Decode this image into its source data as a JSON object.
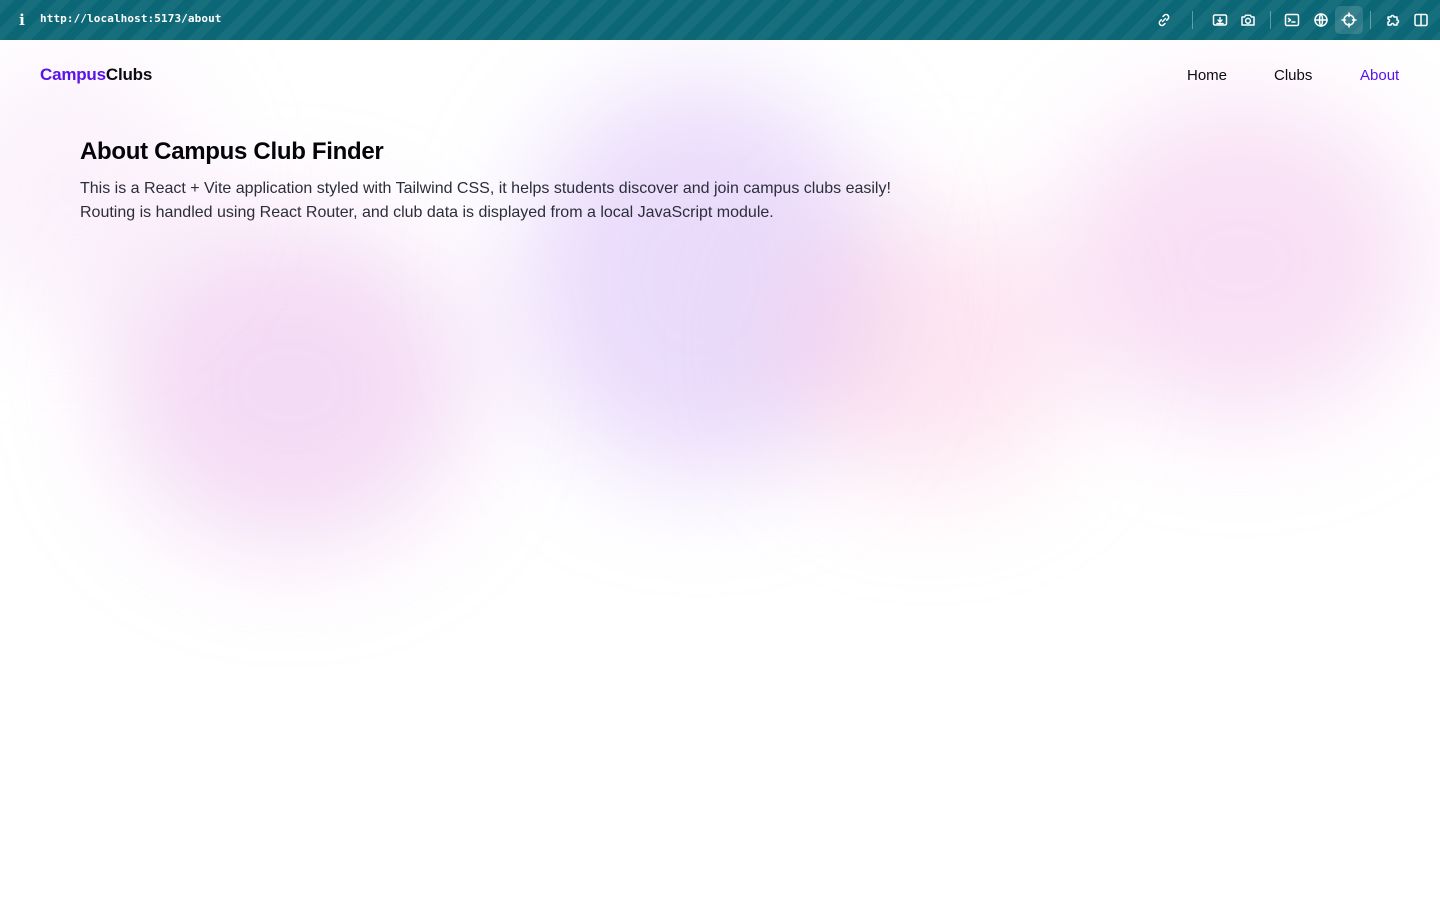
{
  "browser": {
    "url": "http://localhost:5173/about",
    "icons": [
      "info-icon",
      "link-icon",
      "download-icon",
      "camera-icon",
      "terminal-icon",
      "globe-icon",
      "crosshair-icon",
      "extension-icon",
      "split-view-icon"
    ]
  },
  "nav": {
    "logo_part1": "Campus",
    "logo_part2": "Clubs",
    "links": [
      {
        "label": "Home"
      },
      {
        "label": "Clubs"
      },
      {
        "label": "About"
      }
    ],
    "active": "About"
  },
  "main": {
    "title": "About Campus Club Finder",
    "paragraph_line1": "This is a React + Vite application styled with Tailwind CSS, it helps students discover and join campus clubs easily!",
    "paragraph_line2": "Routing is handled using React Router, and club data is displayed from a local JavaScript module."
  },
  "colors": {
    "toolbar": "#0b6675",
    "accent": "#5b14e6",
    "text": "#0b0b12",
    "body_text": "#2b2e3a"
  }
}
